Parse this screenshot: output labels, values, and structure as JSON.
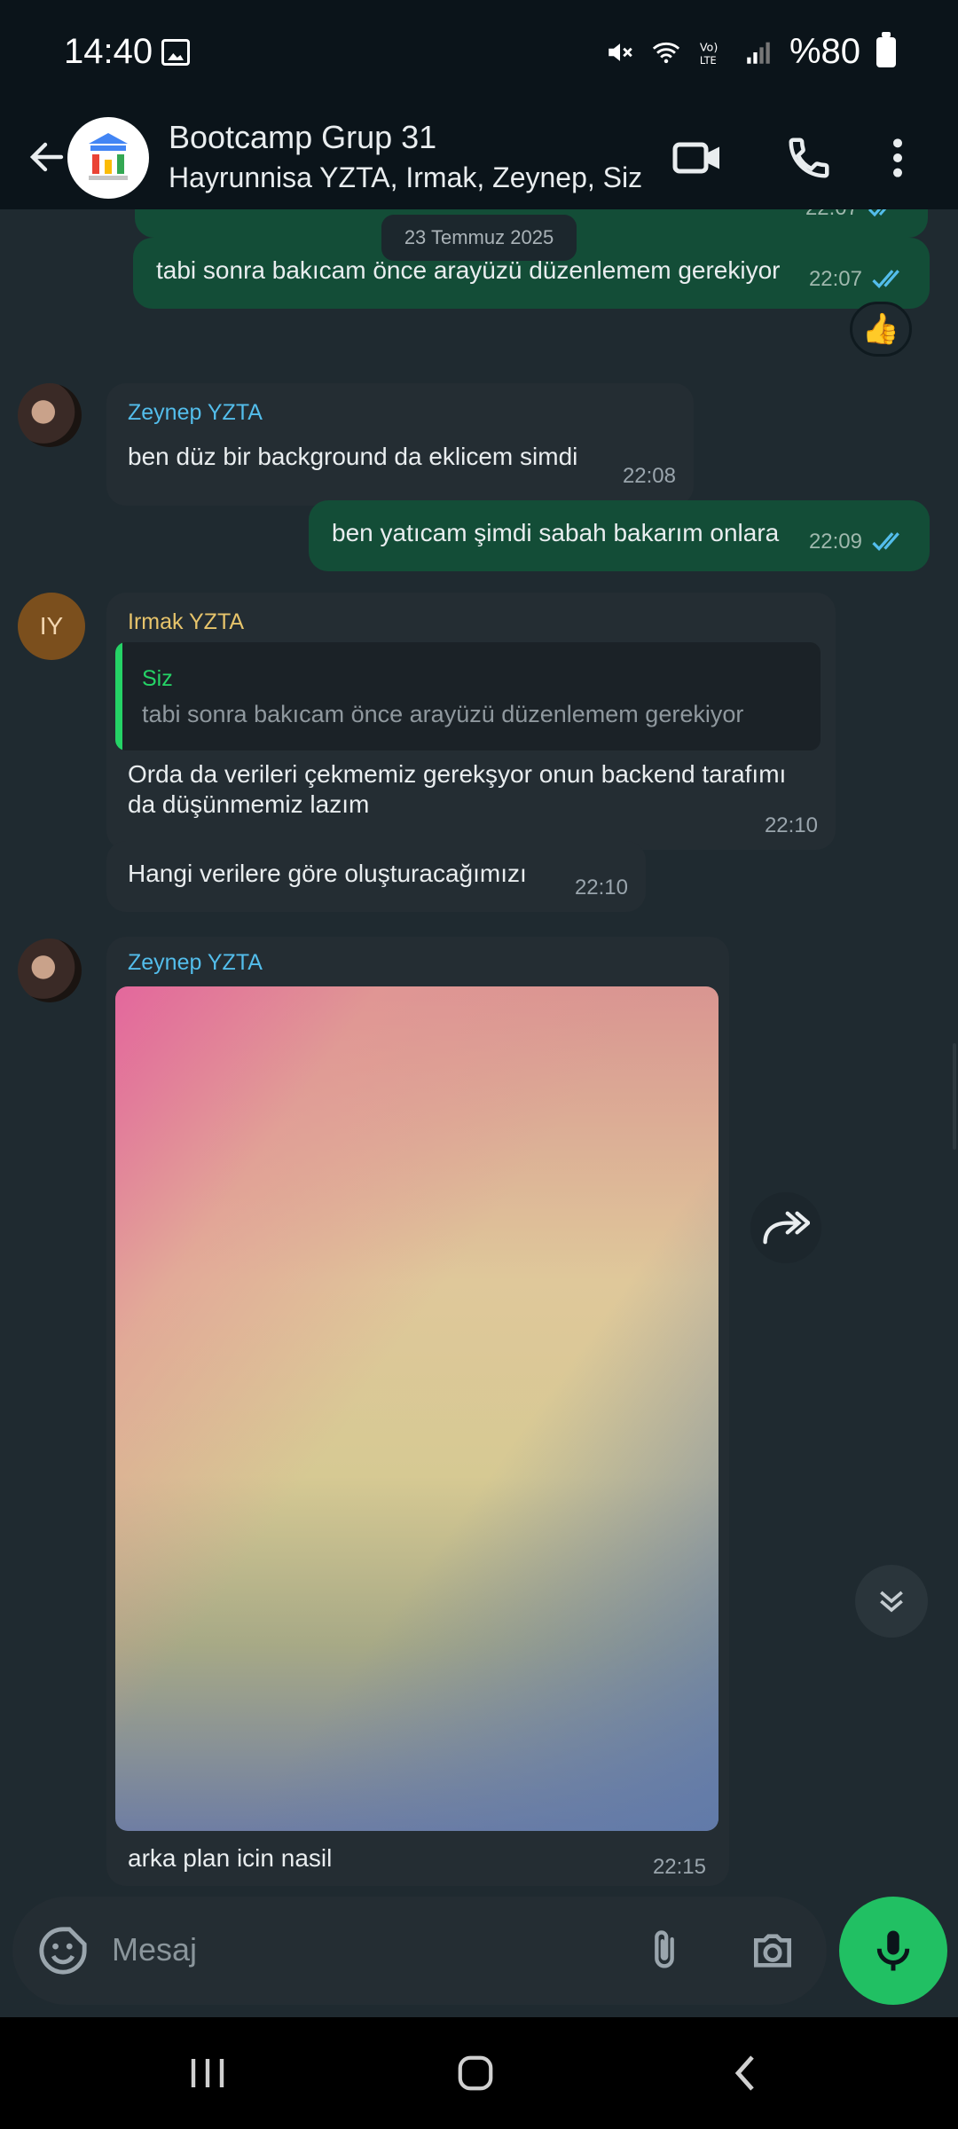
{
  "status": {
    "time": "14:40",
    "battery": "%80"
  },
  "header": {
    "title": "Bootcamp Grup 31",
    "subtitle": "Hayrunnisa YZTA, Irmak, Zeynep, Siz"
  },
  "chat": {
    "date_chip": "23 Temmuz 2025",
    "top_partial_time": "22:07",
    "messages": [
      {
        "text": "tabi sonra bakıcam önce arayüzü düzenlemem gerekiyor",
        "time": "22:07",
        "reaction": "👍"
      },
      {
        "sender": "Zeynep YZTA",
        "text": "ben düz bir background da eklicem simdi",
        "time": "22:08"
      },
      {
        "text": "ben yatıcam şimdi sabah bakarım onlara",
        "time": "22:09"
      },
      {
        "sender": "Irmak YZTA",
        "avatar_initials": "IY",
        "quote_author": "Siz",
        "quote_text": "tabi sonra bakıcam önce arayüzü düzenlemem gerekiyor",
        "text_line1": "Orda da verileri çekmemiz gerekşyor onun backend tarafımı",
        "text_line2": "da düşünmemiz lazım",
        "time": "22:10"
      },
      {
        "text": "Hangi verilere göre oluşturacağımızı",
        "time": "22:10"
      },
      {
        "sender": "Zeynep YZTA",
        "caption": "arka plan icin nasil",
        "time": "22:15"
      }
    ]
  },
  "composer": {
    "placeholder": "Mesaj"
  },
  "colors": {
    "background": "#0b141a",
    "chat_background": "#1f2a30",
    "outgoing_bubble": "#134d37",
    "incoming_bubble": "#242d33",
    "accent_green": "#21c063",
    "zeynep_name": "#53bdeb",
    "irmak_name": "#e7c46b",
    "read_ticks": "#53bdeb"
  },
  "icons": {
    "header": [
      "back-arrow-icon",
      "video-call-icon",
      "voice-call-icon",
      "more-vert-icon"
    ],
    "composer": [
      "sticker-icon",
      "attach-icon",
      "camera-icon",
      "mic-icon"
    ],
    "chat": [
      "forward-icon",
      "scroll-down-icon",
      "double-check-icon"
    ]
  }
}
